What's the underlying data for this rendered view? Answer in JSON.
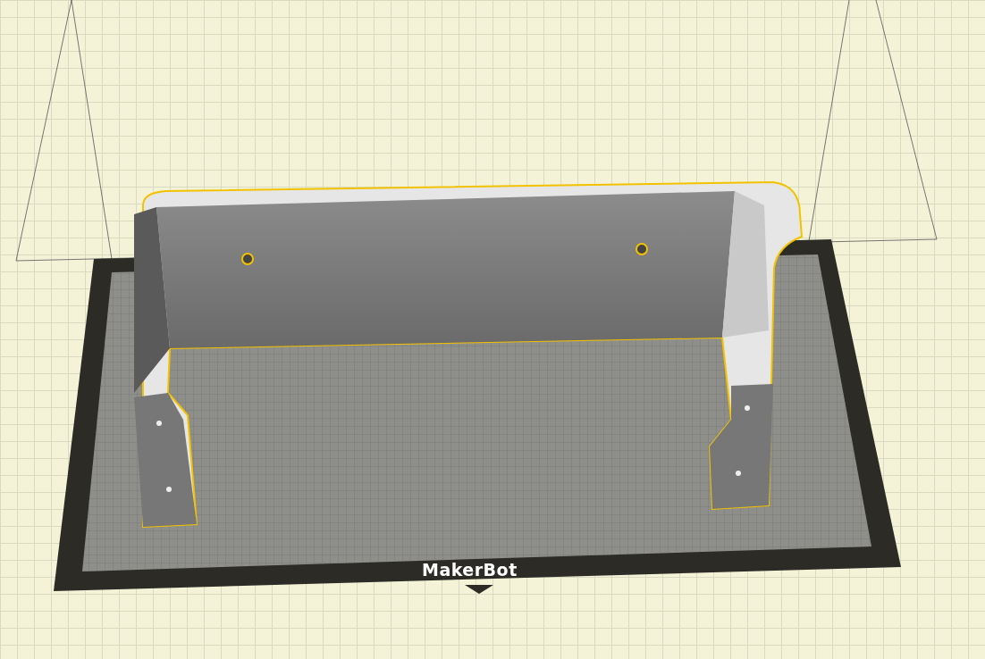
{
  "viewport": {
    "logo": "MakerBot",
    "part": {
      "selected": true
    }
  }
}
